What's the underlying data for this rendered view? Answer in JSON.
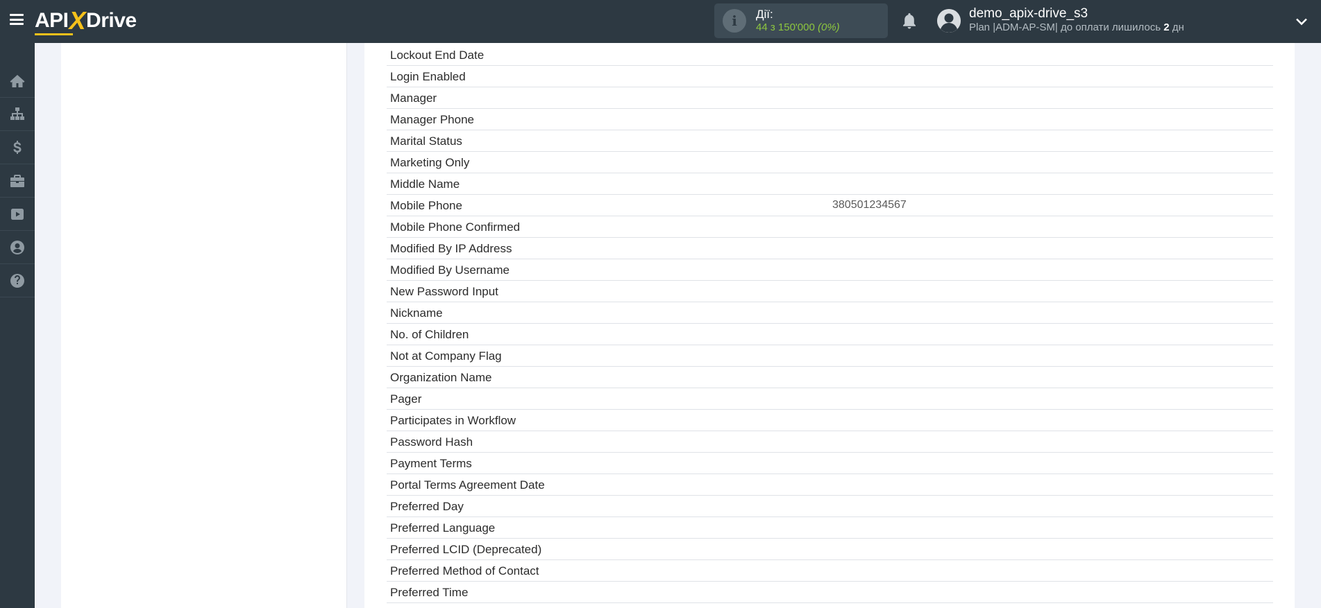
{
  "header": {
    "logo": {
      "left": "API",
      "x": "X",
      "right": "Drive"
    },
    "actions_label": "Дії:",
    "actions_count": "44 з 150'000",
    "actions_percent": "(0%)",
    "user_name": "demo_apix-drive_s3",
    "plan_text": "Plan |ADM-AP-SM| до оплати лишилось ",
    "days_left": "2",
    "days_unit": " дн"
  },
  "sidebar": {
    "items": [
      {
        "name": "home-icon"
      },
      {
        "name": "sitemap-icon"
      },
      {
        "name": "dollar-icon"
      },
      {
        "name": "briefcase-icon"
      },
      {
        "name": "youtube-icon"
      },
      {
        "name": "user-circle-icon"
      },
      {
        "name": "help-icon"
      }
    ]
  },
  "fields": [
    {
      "name": "Lockout End Date",
      "value": ""
    },
    {
      "name": "Login Enabled",
      "value": ""
    },
    {
      "name": "Manager",
      "value": ""
    },
    {
      "name": "Manager Phone",
      "value": ""
    },
    {
      "name": "Marital Status",
      "value": ""
    },
    {
      "name": "Marketing Only",
      "value": ""
    },
    {
      "name": "Middle Name",
      "value": ""
    },
    {
      "name": "Mobile Phone",
      "value": "380501234567"
    },
    {
      "name": "Mobile Phone Confirmed",
      "value": ""
    },
    {
      "name": "Modified By IP Address",
      "value": ""
    },
    {
      "name": "Modified By Username",
      "value": ""
    },
    {
      "name": "New Password Input",
      "value": ""
    },
    {
      "name": "Nickname",
      "value": ""
    },
    {
      "name": "No. of Children",
      "value": ""
    },
    {
      "name": "Not at Company Flag",
      "value": ""
    },
    {
      "name": "Organization Name",
      "value": ""
    },
    {
      "name": "Pager",
      "value": ""
    },
    {
      "name": "Participates in Workflow",
      "value": ""
    },
    {
      "name": "Password Hash",
      "value": ""
    },
    {
      "name": "Payment Terms",
      "value": ""
    },
    {
      "name": "Portal Terms Agreement Date",
      "value": ""
    },
    {
      "name": "Preferred Day",
      "value": ""
    },
    {
      "name": "Preferred Language",
      "value": ""
    },
    {
      "name": "Preferred LCID (Deprecated)",
      "value": ""
    },
    {
      "name": "Preferred Method of Contact",
      "value": ""
    },
    {
      "name": "Preferred Time",
      "value": ""
    }
  ]
}
